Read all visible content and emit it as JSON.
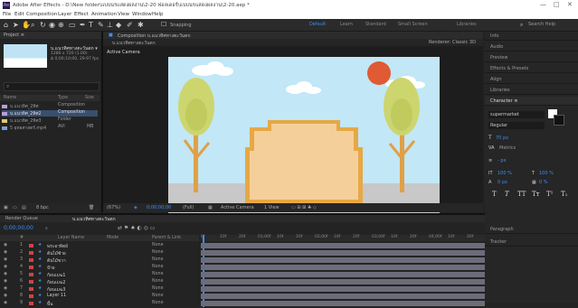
{
  "window": {
    "title": "Adobe After Effects - D:\\New folder\\แบบนรแสดงผลงาน\\2-20 ฟอลเดอร์\\แบบนรแสดงผลงาน\\2-20.aep *",
    "controls": [
      "—",
      "□",
      "✕"
    ]
  },
  "menu": [
    "File",
    "Edit",
    "Composition",
    "Layer",
    "Effect",
    "Animation",
    "View",
    "Window",
    "Help"
  ],
  "toolbar": {
    "snapping_label": "Snapping",
    "help_placeholder": "Search Help"
  },
  "workspaces": [
    {
      "label": "Default",
      "active": true
    },
    {
      "label": "Learn"
    },
    {
      "label": "Standard"
    },
    {
      "label": "Small Screen"
    },
    {
      "label": "Libraries"
    }
  ],
  "project": {
    "panel_title": "Project ≡",
    "comp_name": "บ.แนวทิศทางตะวันตก ▾",
    "comp_meta": [
      "1280 x 720 (1.00)",
      "Δ 0;00;10;00, 29.97 fps"
    ],
    "search_icon": "search-icon",
    "columns": [
      "Name",
      "Type",
      "Size"
    ],
    "items": [
      {
        "name": "บ.แนวทิศ_2ทิศ",
        "type": "Composition",
        "size": "",
        "color": "#b4a0d8"
      },
      {
        "name": "บ.แนวทิศ_2ทิศ2",
        "type": "Composition",
        "size": "",
        "color": "#b4a0d8",
        "selected": true
      },
      {
        "name": "บ.แนวทิศ_2ทิศ3",
        "type": "Folder",
        "size": "",
        "color": "#e8c86a"
      },
      {
        "name": "5 ยุทธศาสตร์.mp4",
        "type": "AVI",
        "size": "MB",
        "color": "#7aa0d8"
      }
    ],
    "bpc": "8 bpc"
  },
  "composition": {
    "panel_title": "Composition บ.แนวทิศทางตะวันตก",
    "tab": "บ.แนวทิศทางตะวันตก",
    "renderer": "Renderer: Classic 3D",
    "active_camera": "Active Camera",
    "zoom": "(67%)",
    "timecode": "0;00;00;00",
    "quality": "(Full)",
    "view_camera": "Active Camera",
    "view_count": "1 View"
  },
  "right_panel": {
    "items": [
      "Info",
      "Audio",
      "Preview",
      "Effects & Presets",
      "Align",
      "Libraries"
    ],
    "character_title": "Character ≡",
    "font_name": "supermarket",
    "font_style": "Regular",
    "size_value": "70 px",
    "tracking_label": "Metrics",
    "stroke": "- px",
    "scale_v": "100 %",
    "scale_h": "100 %",
    "baseline": "0 px",
    "tsume": "0 %",
    "style_buttons": [
      "T",
      "T",
      "TT",
      "Tт",
      "T¹",
      "T₁"
    ],
    "paragraph": "Paragraph",
    "tracker": "Tracker"
  },
  "timeline": {
    "tabs": [
      "Render Queue",
      "บ.แนวทิศทางตะวันตก"
    ],
    "timecode": "0;00;00;00",
    "fps": "00000 (29.97 fps)",
    "columns": [
      "#",
      "Layer Name",
      "Mode",
      "Parent & Link"
    ],
    "ruler": [
      "0f",
      "10f",
      "20f",
      "01;00f",
      "10f",
      "20f",
      "02;00f",
      "10f",
      "20f",
      "03;00f",
      "10f",
      "20f",
      "04;00f",
      "10f",
      "20f"
    ],
    "layers": [
      {
        "n": "1",
        "name": "พระอาทิตย์",
        "parent": "None",
        "color": "#c44"
      },
      {
        "n": "2",
        "name": "ต้นไม้ซ้าย",
        "parent": "None",
        "color": "#c44"
      },
      {
        "n": "3",
        "name": "ต้นไม้ขวา",
        "parent": "None",
        "color": "#c44"
      },
      {
        "n": "4",
        "name": "ป้าย",
        "parent": "None",
        "color": "#c44"
      },
      {
        "n": "5",
        "name": "ก้อนเมฆ1",
        "parent": "None",
        "color": "#c44"
      },
      {
        "n": "6",
        "name": "ก้อนเมฆ2",
        "parent": "None",
        "color": "#c44"
      },
      {
        "n": "7",
        "name": "ก้อนเมฆ3",
        "parent": "None",
        "color": "#c44"
      },
      {
        "n": "8",
        "name": "Layer 11",
        "parent": "None",
        "color": "#c44"
      },
      {
        "n": "9",
        "name": "พื้น",
        "parent": "None",
        "color": "#c44"
      }
    ]
  },
  "scene_colors": {
    "sky": "#c2e7f6",
    "ground": "#c8c8c8",
    "sun": "#e05a34",
    "tree_leaf": "#cdd56e",
    "tree_trunk": "#e0a046",
    "board": "#f5cf9a",
    "board_edge": "#e6a844"
  }
}
